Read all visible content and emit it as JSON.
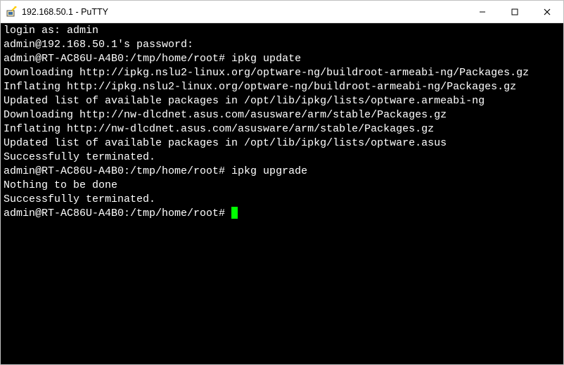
{
  "window": {
    "title": "192.168.50.1 - PuTTY"
  },
  "controls": {
    "min": "—",
    "max": "☐",
    "close": "✕"
  },
  "terminal": {
    "lines": [
      "login as: admin",
      "admin@192.168.50.1's password:",
      "admin@RT-AC86U-A4B0:/tmp/home/root# ipkg update",
      "Downloading http://ipkg.nslu2-linux.org/optware-ng/buildroot-armeabi-ng/Packages.gz",
      "Inflating http://ipkg.nslu2-linux.org/optware-ng/buildroot-armeabi-ng/Packages.gz",
      "Updated list of available packages in /opt/lib/ipkg/lists/optware.armeabi-ng",
      "Downloading http://nw-dlcdnet.asus.com/asusware/arm/stable/Packages.gz",
      "Inflating http://nw-dlcdnet.asus.com/asusware/arm/stable/Packages.gz",
      "Updated list of available packages in /opt/lib/ipkg/lists/optware.asus",
      "Successfully terminated.",
      "admin@RT-AC86U-A4B0:/tmp/home/root# ipkg upgrade",
      "Nothing to be done",
      "Successfully terminated.",
      "admin@RT-AC86U-A4B0:/tmp/home/root# "
    ]
  }
}
